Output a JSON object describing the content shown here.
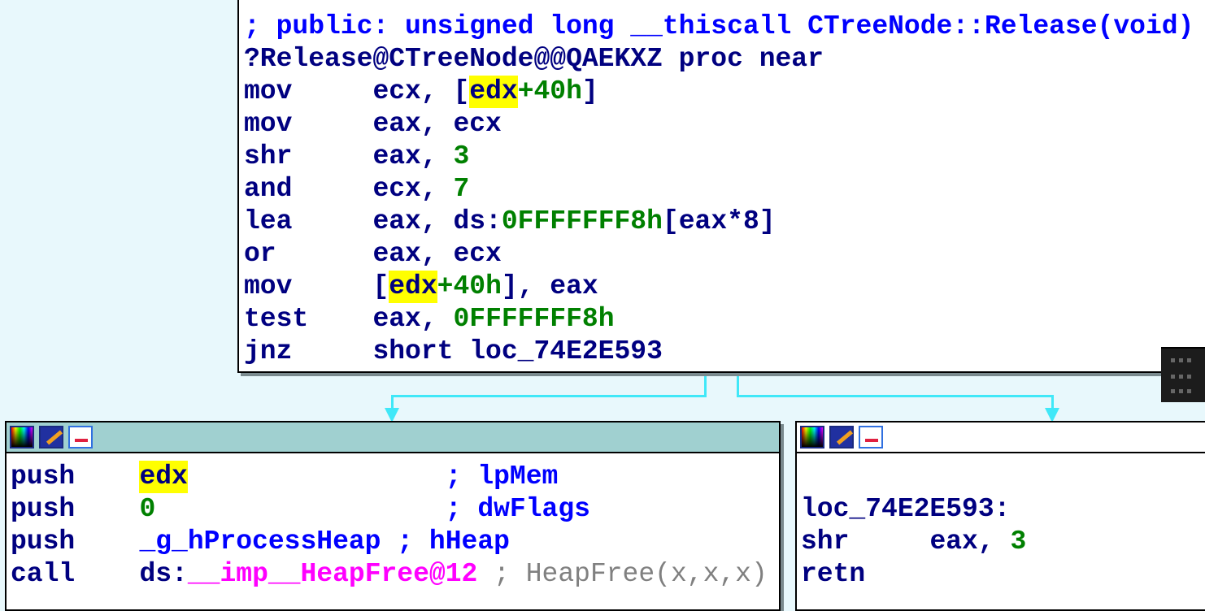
{
  "blocks": {
    "top": {
      "lines": [
        [
          {
            "t": "; public: unsigned long __thiscall CTreeNode::Release(void)",
            "c": "t-cmt"
          }
        ],
        [
          {
            "t": "?Release@CTreeNode@@QAEKXZ proc near",
            "c": "t-pl"
          }
        ],
        [
          {
            "t": "mov     ",
            "c": "t-mn"
          },
          {
            "t": "ecx, [",
            "c": "t-reg"
          },
          {
            "t": "edx",
            "c": "t-reg hl"
          },
          {
            "t": "+40h",
            "c": "t-num"
          },
          {
            "t": "]",
            "c": "t-reg"
          }
        ],
        [
          {
            "t": "mov     ",
            "c": "t-mn"
          },
          {
            "t": "eax, ecx",
            "c": "t-reg"
          }
        ],
        [
          {
            "t": "shr     ",
            "c": "t-mn"
          },
          {
            "t": "eax, ",
            "c": "t-reg"
          },
          {
            "t": "3",
            "c": "t-num"
          }
        ],
        [
          {
            "t": "and     ",
            "c": "t-mn"
          },
          {
            "t": "ecx, ",
            "c": "t-reg"
          },
          {
            "t": "7",
            "c": "t-num"
          }
        ],
        [
          {
            "t": "lea     ",
            "c": "t-mn"
          },
          {
            "t": "eax, ds:",
            "c": "t-reg"
          },
          {
            "t": "0FFFFFFF8h",
            "c": "t-num"
          },
          {
            "t": "[eax*8]",
            "c": "t-reg"
          }
        ],
        [
          {
            "t": "or      ",
            "c": "t-mn"
          },
          {
            "t": "eax, ecx",
            "c": "t-reg"
          }
        ],
        [
          {
            "t": "mov     ",
            "c": "t-mn"
          },
          {
            "t": "[",
            "c": "t-reg"
          },
          {
            "t": "edx",
            "c": "t-reg hl"
          },
          {
            "t": "+40h",
            "c": "t-num"
          },
          {
            "t": "], eax",
            "c": "t-reg"
          }
        ],
        [
          {
            "t": "test    ",
            "c": "t-mn"
          },
          {
            "t": "eax, ",
            "c": "t-reg"
          },
          {
            "t": "0FFFFFFF8h",
            "c": "t-num"
          }
        ],
        [
          {
            "t": "jnz     ",
            "c": "t-mn"
          },
          {
            "t": "short loc_74E2E593",
            "c": "t-reg"
          }
        ]
      ]
    },
    "left": {
      "lines": [
        [
          {
            "t": "push    ",
            "c": "t-mn"
          },
          {
            "t": "edx",
            "c": "t-reg hl"
          },
          {
            "t": "                ; lpMem",
            "c": "t-cmt"
          }
        ],
        [
          {
            "t": "push    ",
            "c": "t-mn"
          },
          {
            "t": "0",
            "c": "t-num"
          },
          {
            "t": "                  ; dwFlags",
            "c": "t-cmt"
          }
        ],
        [
          {
            "t": "push    ",
            "c": "t-mn"
          },
          {
            "t": "_g_hProcessHeap",
            "c": "t-sym"
          },
          {
            "t": " ; hHeap",
            "c": "t-cmt"
          }
        ],
        [
          {
            "t": "call    ",
            "c": "t-mn"
          },
          {
            "t": "ds:",
            "c": "t-reg"
          },
          {
            "t": "__imp__HeapFree@12",
            "c": "t-imp"
          },
          {
            "t": " ; HeapFree(x,x,x)",
            "c": "t-auto"
          }
        ]
      ]
    },
    "right": {
      "lines": [
        [
          {
            "t": " ",
            "c": "t-pl"
          }
        ],
        [
          {
            "t": "loc_74E2E593:",
            "c": "t-pl"
          }
        ],
        [
          {
            "t": "shr     ",
            "c": "t-mn"
          },
          {
            "t": "eax, ",
            "c": "t-reg"
          },
          {
            "t": "3",
            "c": "t-num"
          }
        ],
        [
          {
            "t": "retn",
            "c": "t-mn"
          }
        ]
      ]
    }
  },
  "colors": {
    "background": "#e8f8fc",
    "edge": "#40e8f8",
    "selected_header": "#a0d0d0",
    "highlight": "#ffff00"
  }
}
